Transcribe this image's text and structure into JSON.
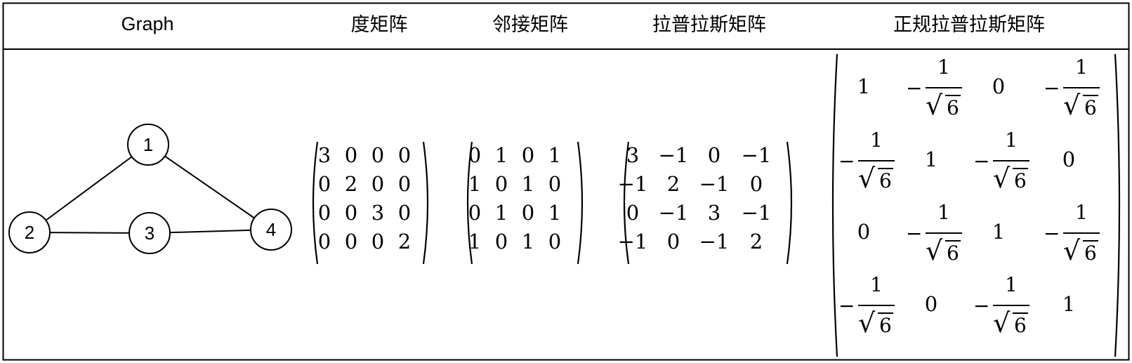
{
  "headers": {
    "graph": "Graph",
    "degree": "度矩阵",
    "adjacency": "邻接矩阵",
    "laplacian": "拉普拉斯矩阵",
    "normalized": "正规拉普拉斯矩阵"
  },
  "graph": {
    "nodes": [
      "1",
      "2",
      "3",
      "4"
    ],
    "edges": [
      [
        "1",
        "2"
      ],
      [
        "1",
        "4"
      ],
      [
        "2",
        "3"
      ],
      [
        "3",
        "4"
      ]
    ]
  },
  "degree_matrix": [
    [
      "3",
      "0",
      "0",
      "0"
    ],
    [
      "0",
      "2",
      "0",
      "0"
    ],
    [
      "0",
      "0",
      "3",
      "0"
    ],
    [
      "0",
      "0",
      "0",
      "2"
    ]
  ],
  "adjacency_matrix": [
    [
      "0",
      "1",
      "0",
      "1"
    ],
    [
      "1",
      "0",
      "1",
      "0"
    ],
    [
      "0",
      "1",
      "0",
      "1"
    ],
    [
      "1",
      "0",
      "1",
      "0"
    ]
  ],
  "laplacian_matrix": [
    [
      "3",
      "−1",
      "0",
      "−1"
    ],
    [
      "−1",
      "2",
      "−1",
      "0"
    ],
    [
      "0",
      "−1",
      "3",
      "−1"
    ],
    [
      "−1",
      "0",
      "−1",
      "2"
    ]
  ],
  "normalized_laplacian": [
    [
      "1",
      "-1/√6",
      "0",
      "-1/√6"
    ],
    [
      "-1/√6",
      "1",
      "-1/√6",
      "0"
    ],
    [
      "0",
      "-1/√6",
      "1",
      "-1/√6"
    ],
    [
      "-1/√6",
      "0",
      "-1/√6",
      "1"
    ]
  ],
  "fraction": {
    "sign": "−",
    "numerator": "1",
    "radicand": "6"
  }
}
